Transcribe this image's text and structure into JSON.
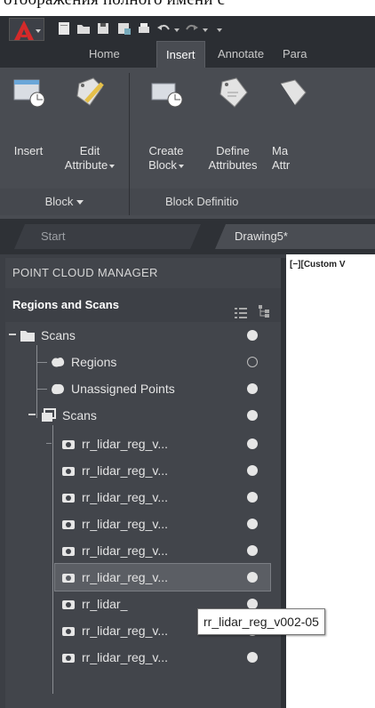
{
  "caption": "отображения полного имени с",
  "tabs": [
    "Home",
    "Insert",
    "Annotate",
    "Para"
  ],
  "ribbon": {
    "buttons": [
      {
        "line1": "Insert",
        "line2": ""
      },
      {
        "line1": "Edit",
        "line2": "Attribute"
      },
      {
        "line1": "Create",
        "line2": "Block"
      },
      {
        "line1": "Define",
        "line2": "Attributes"
      },
      {
        "line1": "Ma",
        "line2": "Attr"
      }
    ],
    "groups": [
      {
        "label": "Block"
      },
      {
        "label": "Block Definitio"
      }
    ]
  },
  "filetabs": {
    "start": "Start",
    "drawing": "Drawing5*"
  },
  "palette": {
    "title": "POINT CLOUD MANAGER",
    "subtitle": "Regions and Scans",
    "tree": [
      {
        "label": "Scans",
        "dot": "filled"
      },
      {
        "label": "Regions",
        "dot": "empty"
      },
      {
        "label": "Unassigned Points",
        "dot": "filled"
      },
      {
        "label": "Scans",
        "dot": "filled"
      },
      {
        "label": "rr_lidar_reg_v...",
        "dot": "filled"
      },
      {
        "label": "rr_lidar_reg_v...",
        "dot": "filled"
      },
      {
        "label": "rr_lidar_reg_v...",
        "dot": "filled"
      },
      {
        "label": "rr_lidar_reg_v...",
        "dot": "filled"
      },
      {
        "label": "rr_lidar_reg_v...",
        "dot": "filled"
      },
      {
        "label": "rr_lidar_reg_v...",
        "dot": "filled"
      },
      {
        "label": "rr_lidar_",
        "dot": "filled"
      },
      {
        "label": "rr_lidar_reg_v...",
        "dot": "filled"
      },
      {
        "label": "rr_lidar_reg_v...",
        "dot": "filled"
      }
    ]
  },
  "viewport_label": "[−][Custom V",
  "tooltip": "rr_lidar_reg_v002-05",
  "colors": {
    "accent_red": "#d42a2a",
    "panel": "#42454b"
  }
}
